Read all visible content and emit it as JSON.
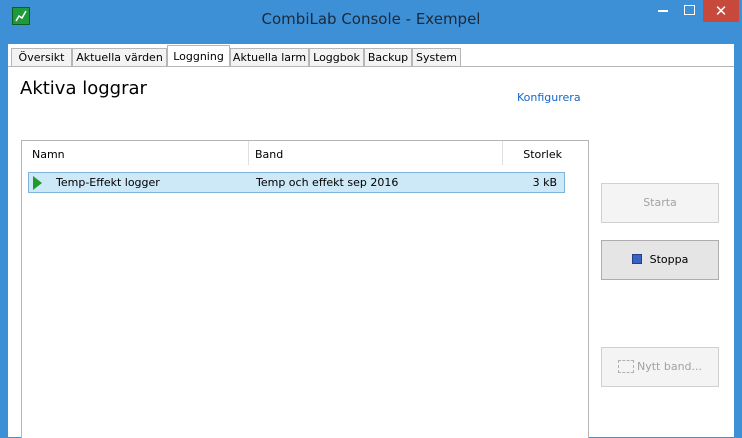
{
  "window": {
    "title": "CombiLab Console - Exempel",
    "controls": {
      "minimize": "–",
      "close": "✕"
    }
  },
  "tabs": [
    {
      "label": "Översikt",
      "active": false
    },
    {
      "label": "Aktuella värden",
      "active": false
    },
    {
      "label": "Loggning",
      "active": true
    },
    {
      "label": "Aktuella larm",
      "active": false
    },
    {
      "label": "Loggbok",
      "active": false
    },
    {
      "label": "Backup",
      "active": false
    },
    {
      "label": "System",
      "active": false
    }
  ],
  "panel": {
    "heading": "Aktiva loggrar",
    "configure_link": "Konfigurera"
  },
  "table": {
    "columns": {
      "name": "Namn",
      "band": "Band",
      "size": "Storlek"
    },
    "rows": [
      {
        "name": "Temp-Effekt logger",
        "band": "Temp och effekt sep 2016",
        "size": "3 kB",
        "status_icon": "play-icon",
        "selected": true
      }
    ]
  },
  "buttons": {
    "start": {
      "label": "Starta",
      "enabled": false
    },
    "stop": {
      "label": "Stoppa",
      "icon": "stop-icon",
      "enabled": true
    },
    "new_band": {
      "label": "Nytt band...",
      "icon": "band-icon",
      "enabled": false
    }
  },
  "colors": {
    "titlebar": "#3d8fd6",
    "close_button": "#c7493c",
    "selected_row": "#cde8f6",
    "link": "#1266c8",
    "play_icon": "#1d9c2c"
  }
}
